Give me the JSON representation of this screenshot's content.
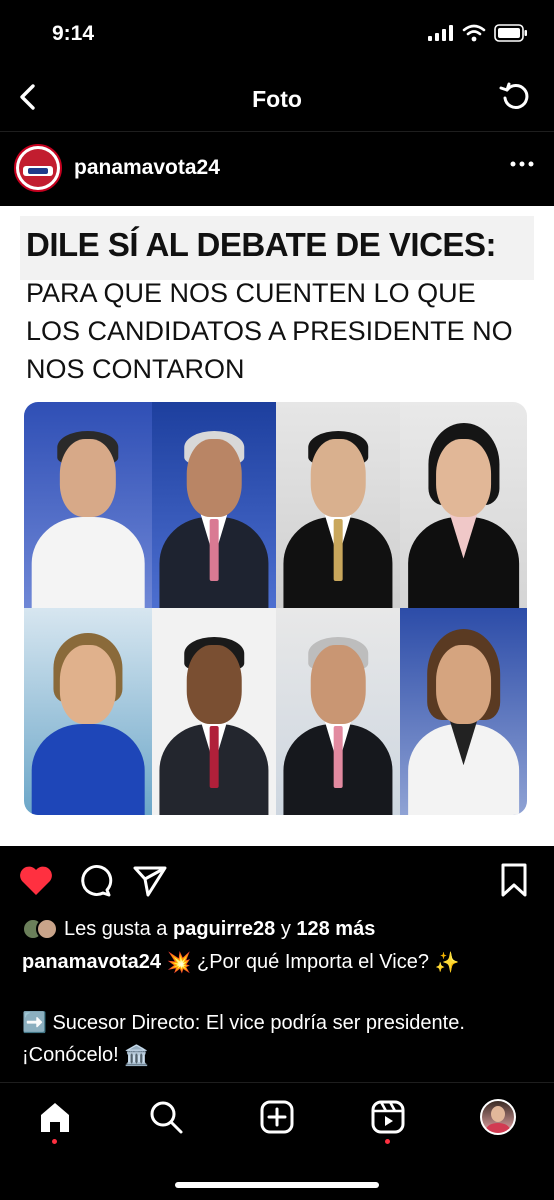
{
  "status_bar": {
    "time": "9:14"
  },
  "nav": {
    "title": "Foto"
  },
  "post": {
    "username": "panamavota24",
    "image": {
      "headline": "DILE SÍ AL DEBATE DE VICES:",
      "subline_1": "PARA QUE NOS CUENTEN LO QUE",
      "subline_2": "LOS CANDIDATOS A PRESIDENTE NO",
      "subline_3": "NOS CONTARON"
    },
    "likes": {
      "prefix": "Les gusta a",
      "user": "paguirre28",
      "connector": "y",
      "count_text": "128 más"
    },
    "caption": {
      "author": "panamavota24",
      "emoji_1": "💥",
      "headline": "¿Por qué Importa el Vice?",
      "emoji_2": "✨",
      "emoji_3": "➡️",
      "line_2": "Sucesor Directo: El vice podría ser presidente. ¡Conócelo!",
      "emoji_4": "🏛️"
    }
  },
  "icons": {
    "back": "chevron-left-icon",
    "refresh": "refresh-icon",
    "more": "more-horizontal-icon",
    "like": "heart-filled-icon",
    "comment": "comment-icon",
    "share": "paper-plane-icon",
    "save": "bookmark-icon",
    "tabs": [
      "home-icon",
      "search-icon",
      "create-icon",
      "reels-icon",
      "profile-avatar"
    ]
  },
  "colors": {
    "background": "#000000",
    "like_red": "#ff3040",
    "text": "#ffffff"
  }
}
